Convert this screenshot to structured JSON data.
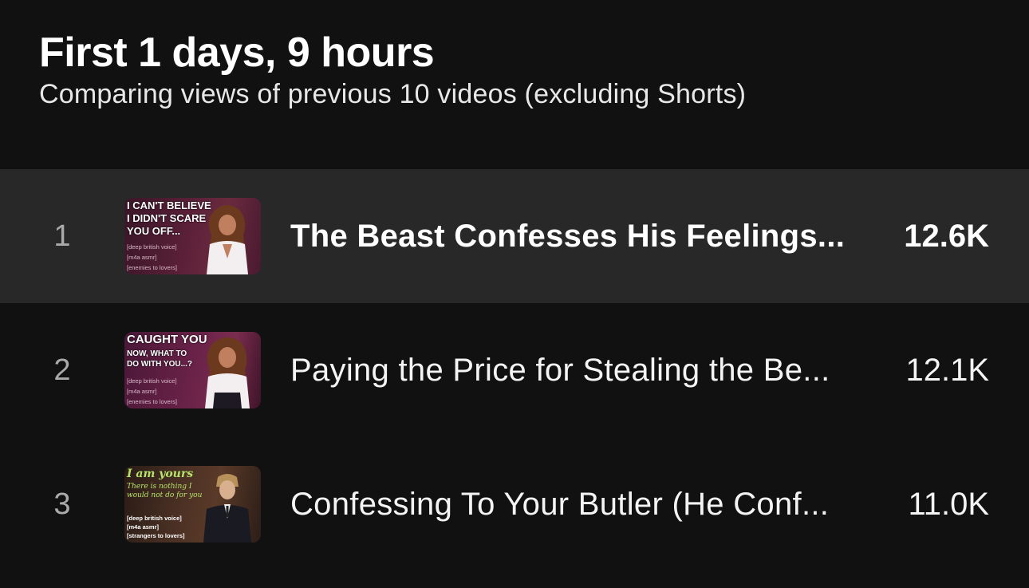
{
  "header": {
    "title": "First 1 days, 9 hours",
    "subtitle": "Comparing views of previous 10 videos (excluding Shorts)"
  },
  "videos": [
    {
      "rank": "1",
      "title": "The Beast Confesses His Feelings...",
      "views": "12.6K",
      "highlighted": true,
      "thumbnail": {
        "headline": [
          "I CAN'T BELIEVE",
          "I DIDN'T SCARE",
          "YOU OFF..."
        ],
        "tags": [
          "[deep british voice]",
          "[m4a asmr]",
          "[enemies to lovers]"
        ]
      }
    },
    {
      "rank": "2",
      "title": "Paying the Price for Stealing the Be...",
      "views": "12.1K",
      "highlighted": false,
      "thumbnail": {
        "headline": [
          "CAUGHT YOU",
          "NOW, WHAT TO",
          "DO WITH YOU...?"
        ],
        "tags": [
          "[deep british voice]",
          "[m4a asmr]",
          "[enemies to lovers]"
        ]
      }
    },
    {
      "rank": "3",
      "title": "Confessing To Your Butler (He Conf...",
      "views": "11.0K",
      "highlighted": false,
      "thumbnail": {
        "headline": [
          "I am yours",
          "There is nothing I",
          "would not do for you"
        ],
        "tags": [
          "[deep british voice]",
          "[m4a asmr]",
          "[strangers to lovers]"
        ]
      }
    }
  ],
  "colors": {
    "background": "#111111",
    "highlight_row": "#282828",
    "accent_green": "#b6e36a"
  }
}
